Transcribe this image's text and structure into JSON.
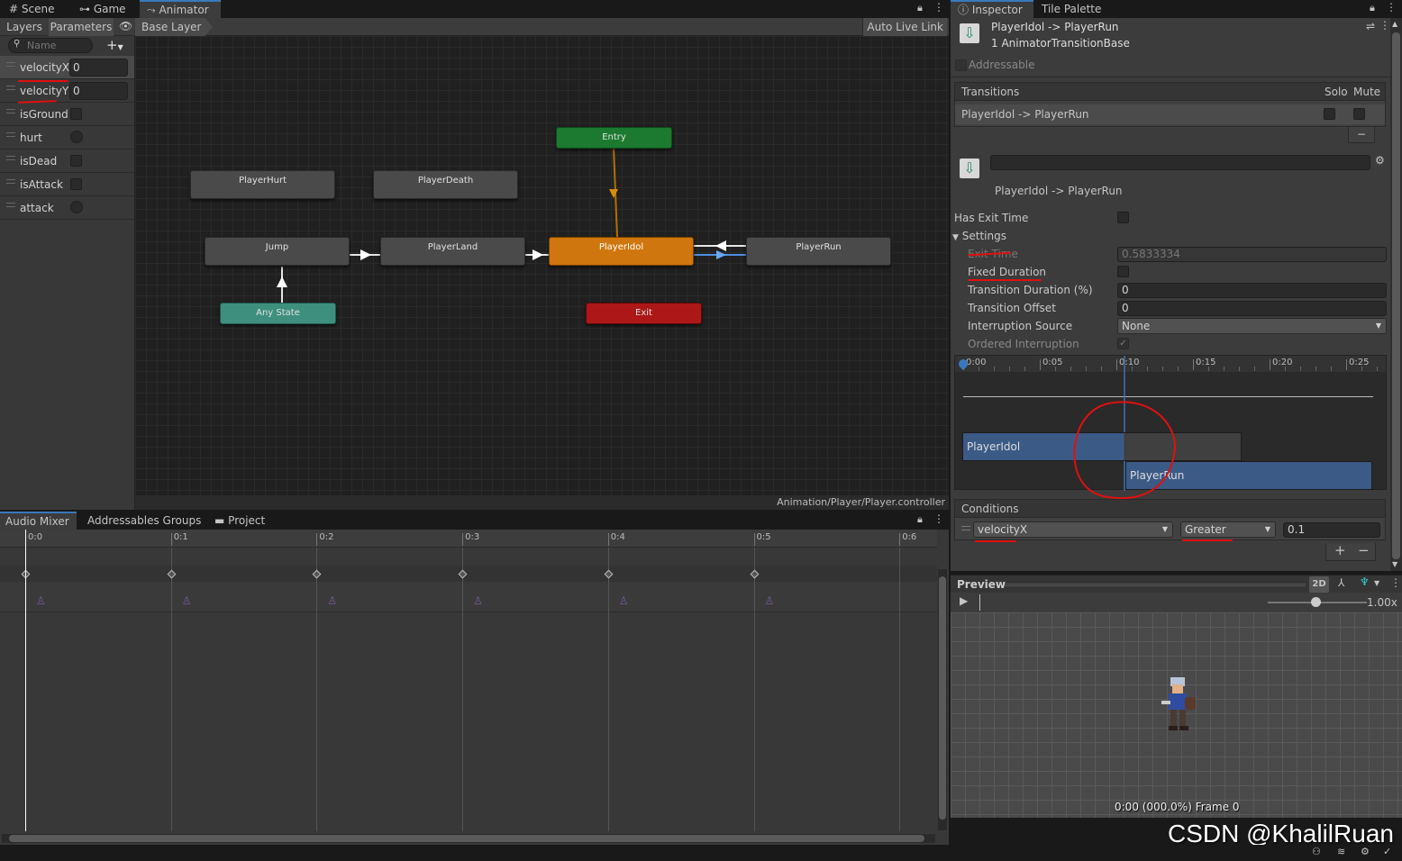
{
  "top_tabs": {
    "scene": "Scene",
    "game": "Game",
    "animator": "Animator"
  },
  "animator": {
    "subtabs": {
      "layers": "Layers",
      "parameters": "Parameters"
    },
    "search_placeholder": "Name",
    "breadcrumb": "Base Layer",
    "auto_live_link": "Auto Live Link",
    "footer_path": "Animation/Player/Player.controller",
    "parameters": [
      {
        "name": "velocityX",
        "type": "float",
        "value": "0"
      },
      {
        "name": "velocityY",
        "type": "float",
        "value": "0"
      },
      {
        "name": "isGround",
        "type": "bool",
        "value": ""
      },
      {
        "name": "hurt",
        "type": "trigger",
        "value": ""
      },
      {
        "name": "isDead",
        "type": "bool",
        "value": ""
      },
      {
        "name": "isAttack",
        "type": "bool",
        "value": ""
      },
      {
        "name": "attack",
        "type": "trigger",
        "value": ""
      }
    ],
    "states": {
      "entry": "Entry",
      "player_hurt": "PlayerHurt",
      "player_death": "PlayerDeath",
      "jump": "Jump",
      "player_land": "PlayerLand",
      "player_idol": "PlayerIdol",
      "player_run": "PlayerRun",
      "any_state": "Any State",
      "exit": "Exit"
    }
  },
  "bottom_tabs": {
    "audio_mixer": "Audio Mixer",
    "addressables": "Addressables Groups",
    "project": "Project"
  },
  "timeline": {
    "ticks": [
      "0:0",
      "0:1",
      "0:2",
      "0:3",
      "0:4",
      "0:5",
      "0:6"
    ]
  },
  "inspector": {
    "tabs": {
      "inspector": "Inspector",
      "tile_palette": "Tile Palette"
    },
    "title": "PlayerIdol -> PlayerRun",
    "subtitle": "1 AnimatorTransitionBase",
    "addressable": "Addressable",
    "transitions_header": "Transitions",
    "solo": "Solo",
    "mute": "Mute",
    "transition_item": "PlayerIdol -> PlayerRun",
    "transition_name": "PlayerIdol -> PlayerRun",
    "has_exit_time": "Has Exit Time",
    "settings": "Settings",
    "exit_time_label": "Exit Time",
    "exit_time_value": "0.5833334",
    "fixed_duration": "Fixed Duration",
    "transition_duration_label": "Transition Duration (%)",
    "transition_duration_value": "0",
    "transition_offset_label": "Transition Offset",
    "transition_offset_value": "0",
    "interruption_source_label": "Interruption Source",
    "interruption_source_value": "None",
    "ordered_interruption": "Ordered Interruption",
    "timeline_ticks": [
      "0:00",
      "0:05",
      "0:10",
      "0:15",
      "0:20",
      "0:25"
    ],
    "bar_from": "PlayerIdol",
    "bar_to": "PlayerRun",
    "conditions_header": "Conditions",
    "condition_param": "velocityX",
    "condition_op": "Greater",
    "condition_value": "0.1"
  },
  "preview": {
    "label": "Preview",
    "mode_2d": "2D",
    "speed": "1.00x",
    "status": "0:00 (000.0%) Frame 0",
    "watermark": "CSDN @KhalilRuan"
  },
  "colors": {
    "accent": "#3a79bb",
    "entry": "#1b7a2f",
    "selected": "#d0760e",
    "any_state": "#3e8f7e",
    "exit": "#ad1717",
    "annotation": "#e01010"
  }
}
